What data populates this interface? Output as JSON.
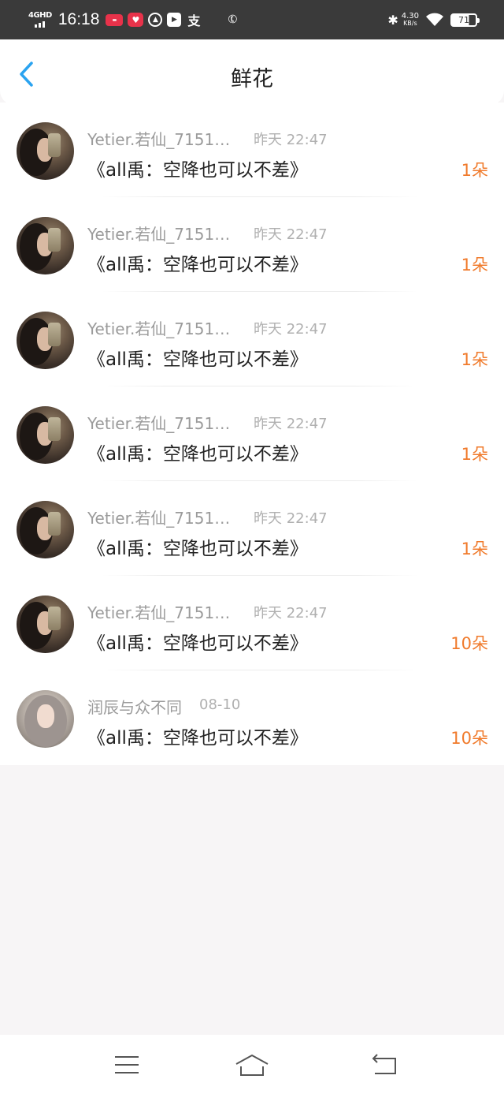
{
  "status_bar": {
    "network": "4GHD",
    "time": "16:18",
    "speed_value": "4.30",
    "speed_unit": "KB/s",
    "battery": "71",
    "icons": [
      "signal-icon",
      "xiaohongshu-icon",
      "heart-app-icon",
      "flame-app-icon",
      "play-app-icon",
      "zhi-app-icon",
      "phone-icon",
      "bluetooth-icon",
      "wifi-icon",
      "battery-icon"
    ]
  },
  "header": {
    "title": "鲜花",
    "back_icon": "chevron-left-icon",
    "accent_color": "#2aa3f0"
  },
  "rows": [
    {
      "name": "Yetier.若仙_7151…",
      "time": "昨天 22:47",
      "book": "《all禹：空降也可以不差》",
      "count": "1朵"
    },
    {
      "name": "Yetier.若仙_7151…",
      "time": "昨天 22:47",
      "book": "《all禹：空降也可以不差》",
      "count": "1朵"
    },
    {
      "name": "Yetier.若仙_7151…",
      "time": "昨天 22:47",
      "book": "《all禹：空降也可以不差》",
      "count": "1朵"
    },
    {
      "name": "Yetier.若仙_7151…",
      "time": "昨天 22:47",
      "book": "《all禹：空降也可以不差》",
      "count": "1朵"
    },
    {
      "name": "Yetier.若仙_7151…",
      "time": "昨天 22:47",
      "book": "《all禹：空降也可以不差》",
      "count": "1朵"
    },
    {
      "name": "Yetier.若仙_7151…",
      "time": "昨天 22:47",
      "book": "《all禹：空降也可以不差》",
      "count": "10朵"
    },
    {
      "name": "润辰与众不同",
      "time": "08-10",
      "book": "《all禹：空降也可以不差》",
      "count": "10朵"
    }
  ],
  "colors": {
    "count": "#f07a2b",
    "name": "#9b9b9b",
    "background": "#f7f5f6"
  },
  "nav_bar": {
    "icons": [
      "menu-icon",
      "home-icon",
      "back-icon"
    ]
  }
}
